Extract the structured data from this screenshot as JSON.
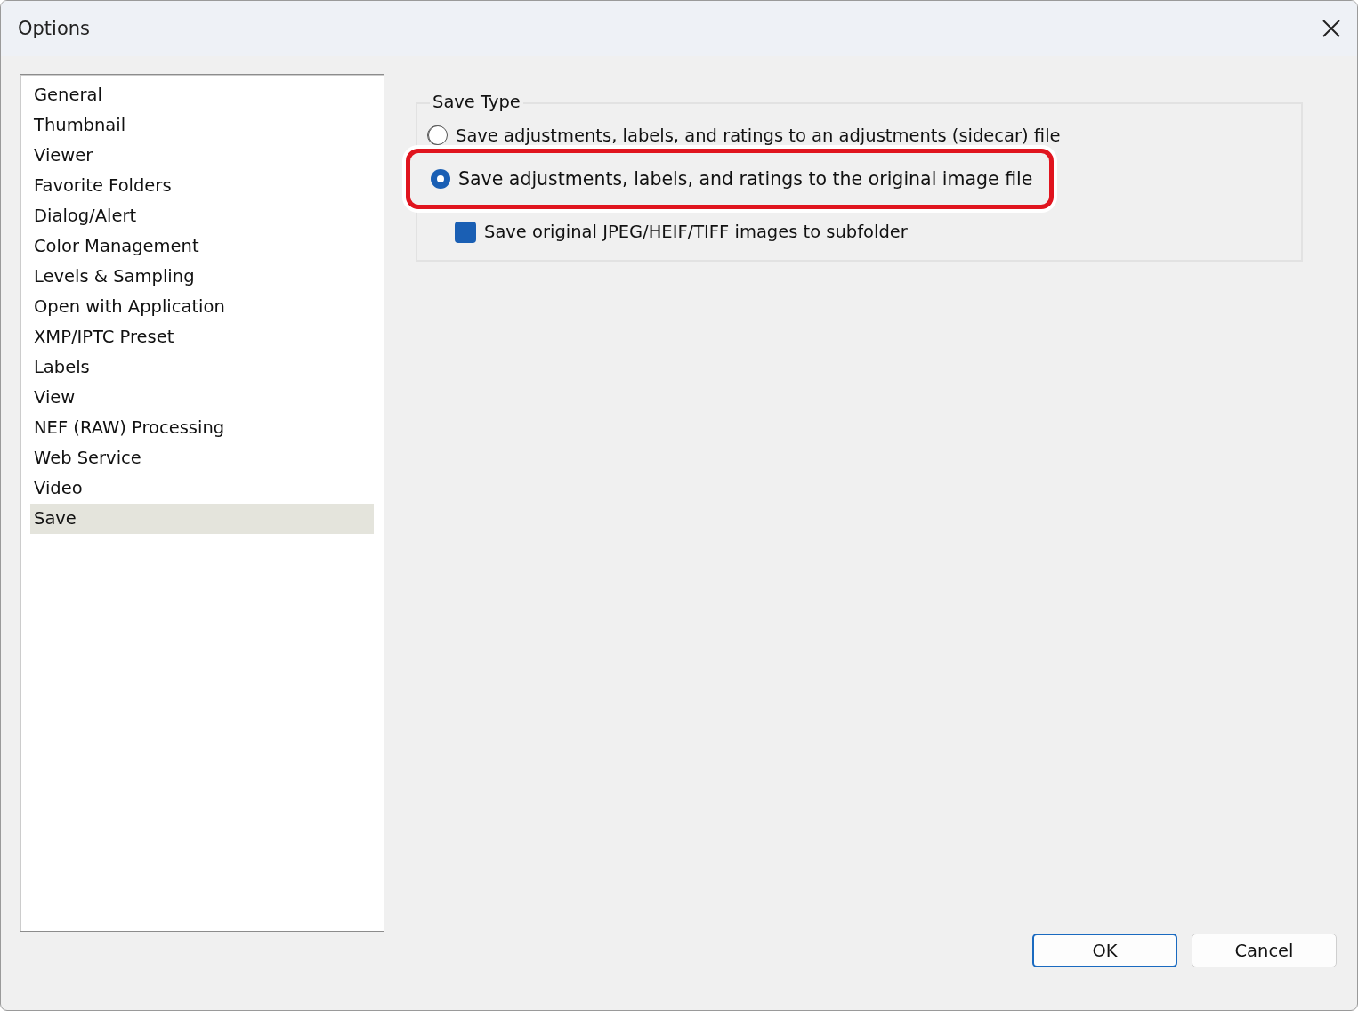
{
  "window": {
    "title": "Options"
  },
  "sidebar": {
    "items": [
      {
        "label": "General",
        "selected": false
      },
      {
        "label": "Thumbnail",
        "selected": false
      },
      {
        "label": "Viewer",
        "selected": false
      },
      {
        "label": "Favorite Folders",
        "selected": false
      },
      {
        "label": "Dialog/Alert",
        "selected": false
      },
      {
        "label": "Color Management",
        "selected": false
      },
      {
        "label": "Levels & Sampling",
        "selected": false
      },
      {
        "label": "Open with Application",
        "selected": false
      },
      {
        "label": "XMP/IPTC Preset",
        "selected": false
      },
      {
        "label": "Labels",
        "selected": false
      },
      {
        "label": "View",
        "selected": false
      },
      {
        "label": "NEF (RAW) Processing",
        "selected": false
      },
      {
        "label": "Web Service",
        "selected": false
      },
      {
        "label": "Video",
        "selected": false
      },
      {
        "label": "Save",
        "selected": true
      }
    ]
  },
  "save_type": {
    "title": "Save Type",
    "options": [
      {
        "kind": "radio",
        "label": "Save adjustments, labels, and ratings to an adjustments (sidecar) file",
        "selected": false,
        "highlighted": false
      },
      {
        "kind": "radio",
        "label": "Save adjustments, labels, and ratings to the original image file",
        "selected": true,
        "highlighted": true
      },
      {
        "kind": "checkbox",
        "label": "Save original JPEG/HEIF/TIFF images to subfolder",
        "checked": true,
        "highlighted": false
      }
    ]
  },
  "buttons": [
    {
      "label": "OK",
      "default": true
    },
    {
      "label": "Cancel",
      "default": false
    }
  ]
}
